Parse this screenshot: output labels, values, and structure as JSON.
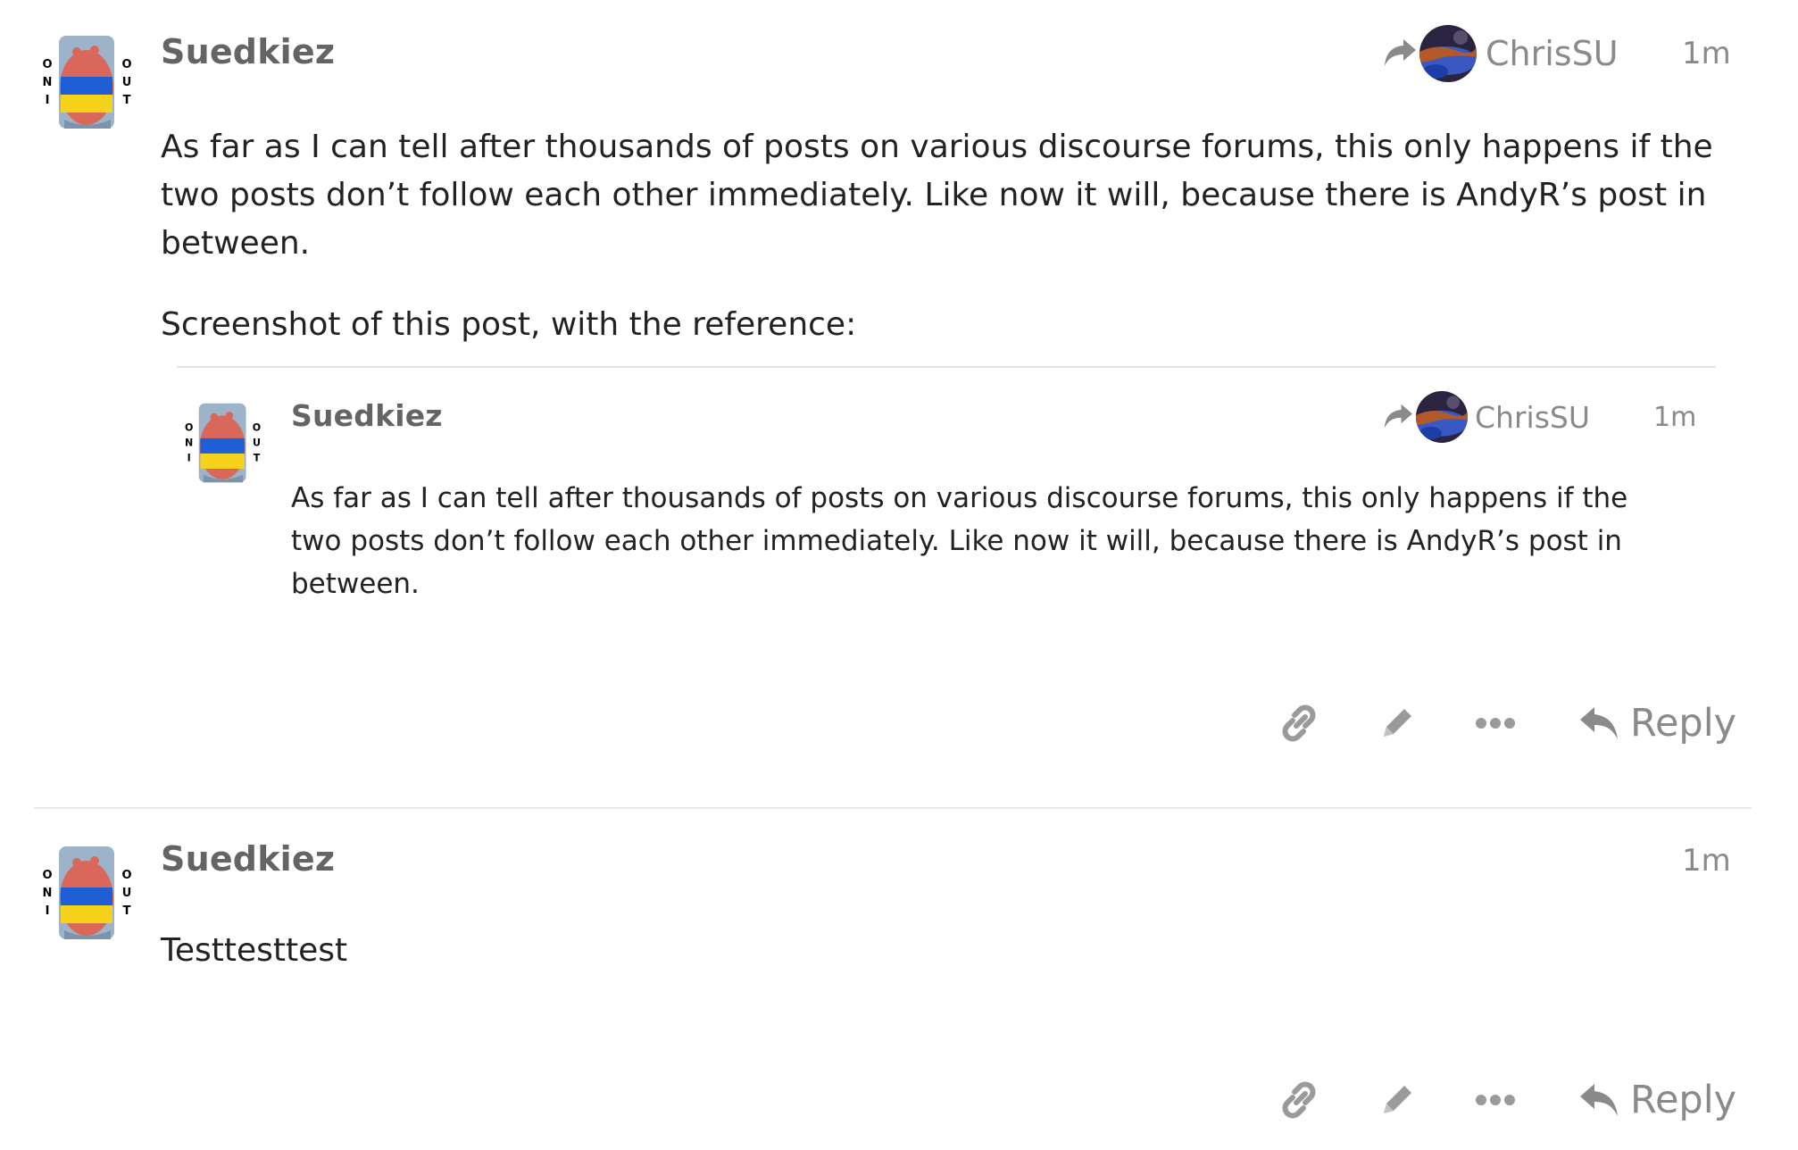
{
  "posts": [
    {
      "username": "Suedkiez",
      "reply_to": "ChrisSU",
      "time": "1m",
      "paragraphs": [
        "As far as I can tell after thousands of posts on various discourse forums, this only happens if the two posts don’t follow each other immediately. Like now it will, because there is AndyR’s post in between.",
        "Screenshot of this post, with the reference:"
      ],
      "embedded_screenshot": {
        "username": "Suedkiez",
        "reply_to": "ChrisSU",
        "time": "1m",
        "text": "As far as I can tell after thousands of posts on various discourse forums, this only happens if the two posts don’t follow each other immediately. Like now it will, because there is AndyR’s post in between."
      },
      "reply_label": "Reply"
    },
    {
      "username": "Suedkiez",
      "time": "1m",
      "paragraphs": [
        "Testtesttest"
      ],
      "reply_label": "Reply"
    }
  ],
  "avatar_text": {
    "left": [
      "O",
      "N",
      "I"
    ],
    "right": [
      "O",
      "U",
      "T"
    ]
  },
  "icons": [
    "reply-to-arrow-icon",
    "link-icon",
    "pencil-icon",
    "more-icon",
    "reply-icon"
  ],
  "colors": {
    "username": "#646464",
    "meta": "#8a8a8a",
    "icon": "#9a9a9a",
    "divider": "#e9e9e9",
    "flag_blue": "#1f5fd6",
    "flag_yellow": "#f7d21b"
  }
}
